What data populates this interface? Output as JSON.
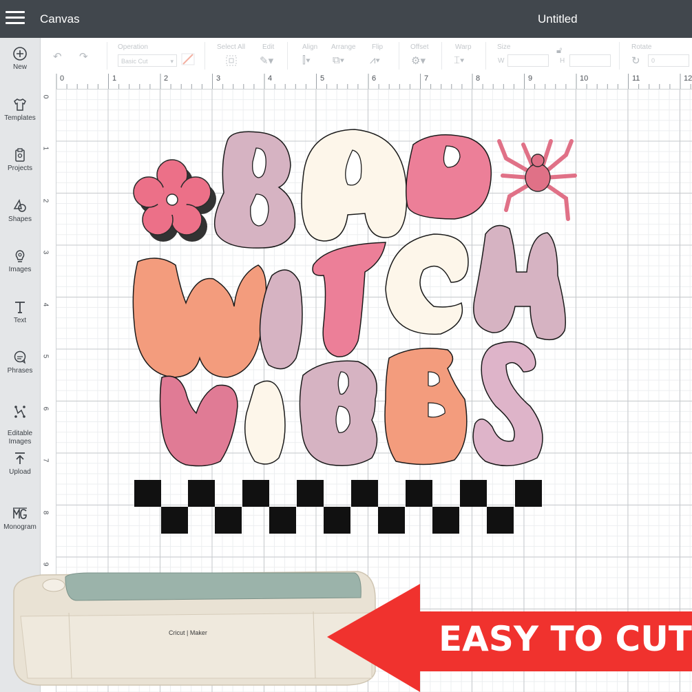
{
  "header": {
    "app_title": "Canvas",
    "doc_title": "Untitled"
  },
  "sidebar": {
    "items": [
      {
        "label": "New",
        "icon": "plus-circle-icon"
      },
      {
        "label": "Templates",
        "icon": "tshirt-icon"
      },
      {
        "label": "Projects",
        "icon": "clipboard-icon"
      },
      {
        "label": "Shapes",
        "icon": "shapes-icon"
      },
      {
        "label": "Images",
        "icon": "bulb-icon"
      },
      {
        "label": "Text",
        "icon": "text-icon"
      },
      {
        "label": "Phrases",
        "icon": "speech-bubble-icon"
      },
      {
        "label": "Editable\nImages",
        "icon": "editable-image-icon"
      },
      {
        "label": "Upload",
        "icon": "upload-icon"
      },
      {
        "label": "Monogram",
        "icon": "monogram-icon"
      }
    ]
  },
  "toolbar": {
    "operation_label": "Operation",
    "operation_value": "Basic Cut",
    "select_all_label": "Select All",
    "edit_label": "Edit",
    "align_label": "Align",
    "arrange_label": "Arrange",
    "flip_label": "Flip",
    "offset_label": "Offset",
    "warp_label": "Warp",
    "size_label": "Size",
    "w_label": "W",
    "h_label": "H",
    "rotate_label": "Rotate",
    "rotate_value": "0"
  },
  "rulers": {
    "top": [
      "0",
      "1",
      "2",
      "3",
      "4",
      "5",
      "6",
      "7",
      "8",
      "9",
      "10",
      "11",
      "12"
    ],
    "left": [
      "0",
      "1",
      "2",
      "3",
      "4",
      "5",
      "6",
      "7",
      "8",
      "9"
    ]
  },
  "design": {
    "lines": [
      "BAD",
      "WITCH",
      "VIBES"
    ],
    "colors": {
      "mauve": "#d6b3c2",
      "cream": "#fdf6ea",
      "pink": "#ec7f98",
      "peach": "#f39c7d",
      "black": "#111111"
    }
  },
  "promo": {
    "machine_brand": "Cricut | Maker",
    "callout": "EASY TO CUT",
    "callout_color": "#f0322e"
  }
}
